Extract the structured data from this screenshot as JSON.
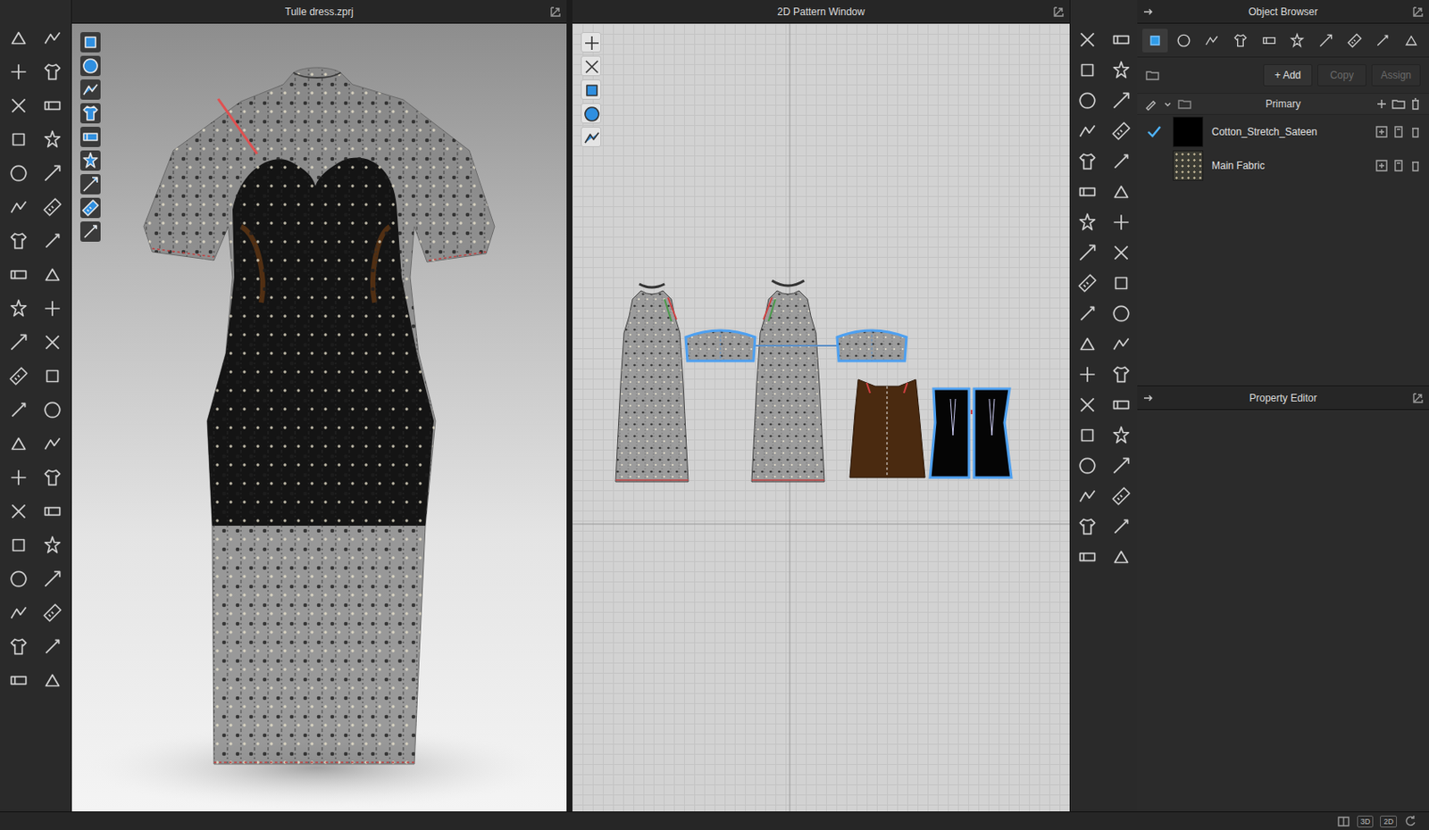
{
  "viewport3d": {
    "title": "Tulle dress.zprj"
  },
  "pattern2d": {
    "title": "2D Pattern Window"
  },
  "object_browser": {
    "title": "Object Browser",
    "buttons": [
      {
        "label": "+ Add",
        "disabled": false
      },
      {
        "label": "Copy",
        "disabled": true
      },
      {
        "label": "Assign",
        "disabled": true
      }
    ],
    "group": "Primary",
    "fabrics": [
      {
        "name": "Cotton_Stretch_Sateen",
        "selected": true,
        "color": "#000000"
      },
      {
        "name": "Main Fabric",
        "selected": false,
        "color": "#3a3a33"
      }
    ]
  },
  "property_editor": {
    "title": "Property Editor"
  },
  "status_bar": {
    "buttons": [
      "3D",
      "2D"
    ]
  }
}
